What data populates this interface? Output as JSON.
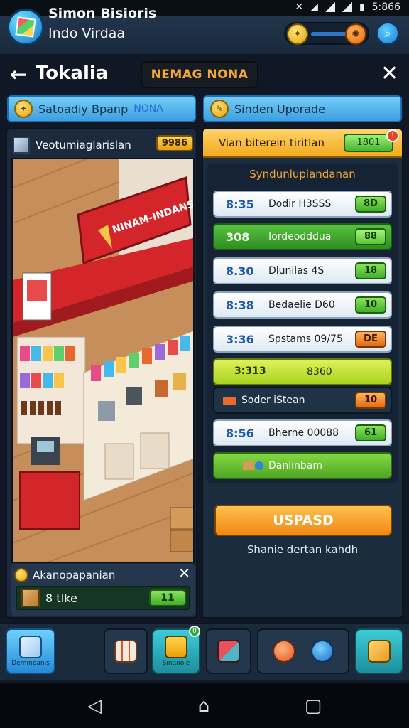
{
  "status_bar": {
    "time": "5:866"
  },
  "header": {
    "title": "Simon Bisioris",
    "subtitle": "Indo Virdaa"
  },
  "title_row": {
    "title": "Tokalia",
    "banner": "NEMAG NONA"
  },
  "tabs": [
    {
      "label": "Satoadiy Bpanp",
      "extra": "NONA"
    },
    {
      "label": "Sinden Uporade"
    }
  ],
  "left_panel": {
    "title": "Veotumiaglarislan",
    "badge": "9986",
    "sign_text": "NINAM-INDANSIA",
    "footer": {
      "title": "Akanopapanian",
      "item_label": "8 tIke",
      "item_button": "11"
    }
  },
  "right_panel": {
    "header_label": "Vian biterein tiritlan",
    "header_pill": "1801",
    "section_title": "Syndunlupiandanan",
    "orders": [
      {
        "time": "8:35",
        "name": "Dodir H3SSS",
        "button": "8D",
        "style": "white"
      },
      {
        "time": "308",
        "name": "Iordeodddua",
        "button": "88",
        "style": "green"
      },
      {
        "time": "8.30",
        "name": "Dlunilas 4S",
        "button": "18",
        "style": "white"
      },
      {
        "time": "8:38",
        "name": "Bedaelie D60",
        "button": "10",
        "style": "white"
      },
      {
        "time": "3:36",
        "name": "Spstams 09/75",
        "button": "DE",
        "style": "orange"
      },
      {
        "time": "3:313",
        "name": "8360",
        "button": "",
        "style": "lime"
      },
      {
        "time": "",
        "name": "Soder iStean",
        "button": "10",
        "style": "dark"
      },
      {
        "time": "8:56",
        "name": "Bherne 00088",
        "button": "61",
        "style": "white"
      },
      {
        "time": "",
        "name": "Danlinbam",
        "button": "",
        "style": "green2"
      }
    ],
    "upgrade_button": "USPASD",
    "upgrade_caption": "Shanie dertan kahdh"
  },
  "toolbar": {
    "home_label": "Deminbanis",
    "shop_label": "Sinanole",
    "shop_badge": "0"
  },
  "colors": {
    "accent_blue": "#3d9fe0",
    "accent_orange": "#f08a13",
    "panel_bg": "#1c2c3f",
    "green": "#3fae2a"
  }
}
